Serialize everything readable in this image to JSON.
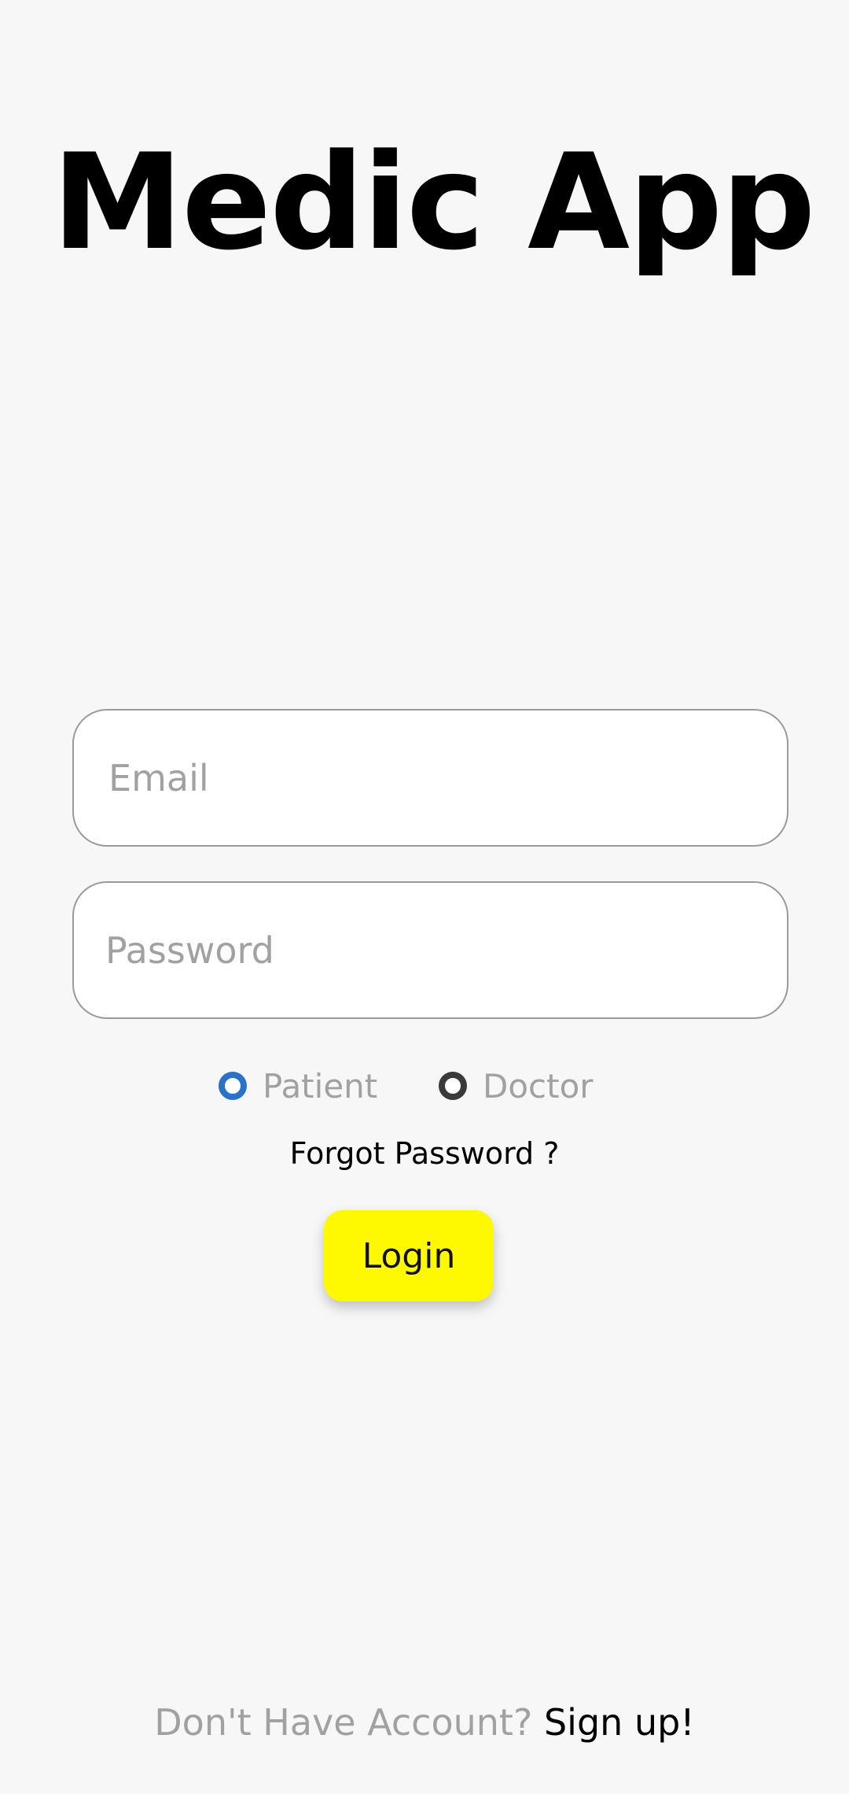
{
  "app": {
    "title": "Medic App"
  },
  "login_form": {
    "email": {
      "placeholder": "Email",
      "value": ""
    },
    "password": {
      "placeholder": "Password",
      "value": ""
    },
    "roles": [
      {
        "label": "Patient",
        "selected": true
      },
      {
        "label": "Doctor",
        "selected": false
      }
    ],
    "forgot_password_label": "Forgot Password ?",
    "login_label": "Login"
  },
  "footer": {
    "prompt": "Don't Have Account?",
    "signup_label": "Sign up!"
  },
  "colors": {
    "background": "#f7f7f7",
    "accent_button": "#fff900",
    "radio_selected": "#2a72c7",
    "radio_unselected": "#3a3a3a",
    "placeholder_text": "#a1a1a1"
  }
}
